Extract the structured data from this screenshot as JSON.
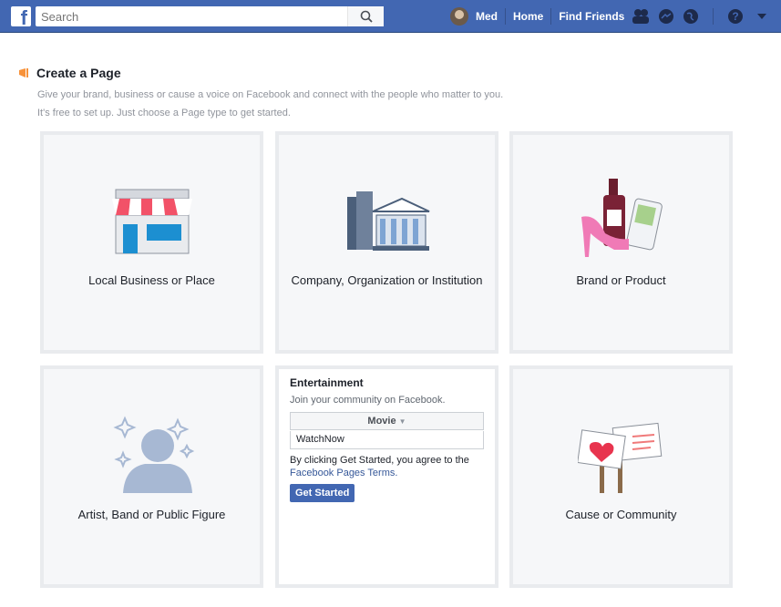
{
  "topbar": {
    "logo": "f",
    "search_placeholder": "Search",
    "user_name": "Med",
    "home": "Home",
    "find_friends": "Find Friends"
  },
  "header": {
    "title": "Create a Page",
    "line1": "Give your brand, business or cause a voice on Facebook and connect with the people who matter to you.",
    "line2": "It's free to set up. Just choose a Page type to get started."
  },
  "cards": [
    {
      "label": "Local Business or Place"
    },
    {
      "label": "Company, Organization or Institution"
    },
    {
      "label": "Brand or Product"
    },
    {
      "label": "Artist, Band or Public Figure"
    },
    {
      "title": "Entertainment",
      "subtitle": "Join your community on Facebook.",
      "category": "Movie",
      "name_value": "WatchNow",
      "agree_text": "By clicking Get Started, you agree to the",
      "terms_link": "Facebook Pages Terms.",
      "button": "Get Started"
    },
    {
      "label": "Cause or Community"
    }
  ]
}
